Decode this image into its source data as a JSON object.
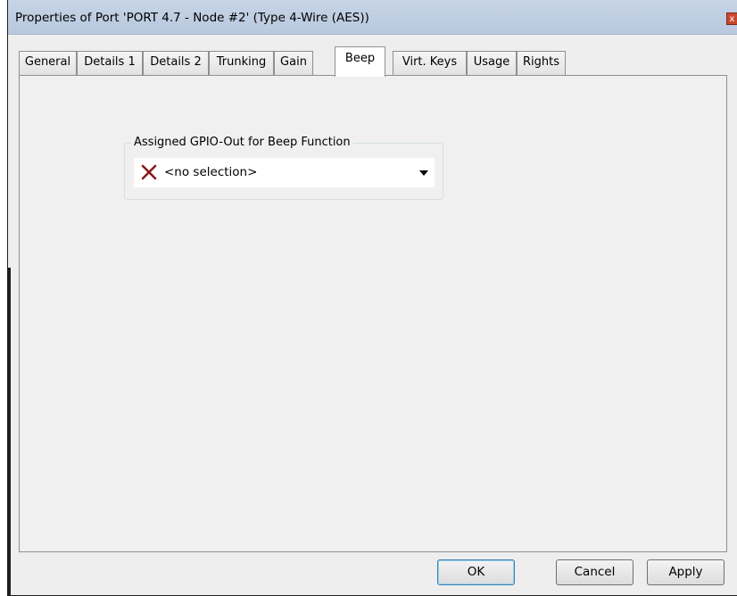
{
  "window": {
    "title": "Properties of Port 'PORT 4.7 - Node #2' (Type 4-Wire (AES))",
    "close_glyph": "x"
  },
  "tabs": [
    {
      "label": "General",
      "active": false
    },
    {
      "label": "Details 1",
      "active": false
    },
    {
      "label": "Details 2",
      "active": false
    },
    {
      "label": "Trunking",
      "active": false
    },
    {
      "label": "Gain",
      "active": false
    },
    {
      "label": "Beep",
      "active": true
    },
    {
      "label": "Virt. Keys",
      "active": false
    },
    {
      "label": "Usage",
      "active": false
    },
    {
      "label": "Rights",
      "active": false
    }
  ],
  "beep": {
    "group_label": "Assigned GPIO-Out for Beep Function",
    "selected_value": "<no selection>",
    "selected_icon": "red-x-icon"
  },
  "buttons": {
    "ok": "OK",
    "cancel": "Cancel",
    "apply": "Apply"
  },
  "colors": {
    "x_icon": "#8b1a1a",
    "titlebar": "#c7d4e6"
  }
}
